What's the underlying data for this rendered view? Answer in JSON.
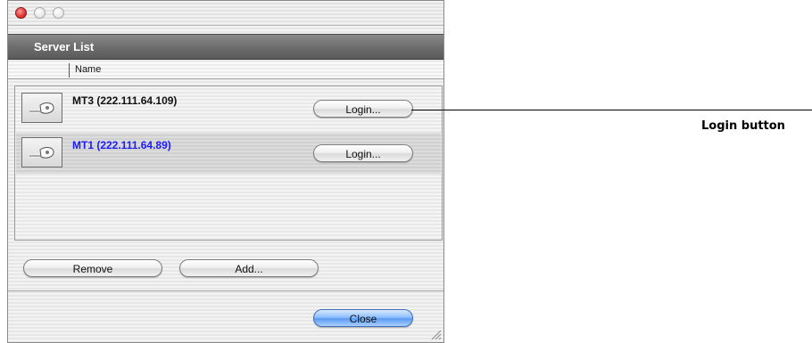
{
  "window": {
    "header_title": "Server List",
    "column_header": "Name"
  },
  "servers": [
    {
      "name": "MT3 (222.111.64.109)",
      "login_label": "Login...",
      "selected": false
    },
    {
      "name": "MT1 (222.111.64.89)",
      "login_label": "Login...",
      "selected": true
    }
  ],
  "actions": {
    "remove_label": "Remove",
    "add_label": "Add...",
    "close_label": "Close"
  },
  "callout": {
    "label": "Login button"
  },
  "colors": {
    "selected_text": "#1a1aff",
    "header_bar": "#6e6e6e",
    "primary_button": "#5c9bf2",
    "close_light": "#e0393b"
  },
  "icons": {
    "server": "server-key-icon",
    "close_light": "close-window-icon",
    "minimize_light": "minimize-window-icon",
    "zoom_light": "zoom-window-icon",
    "resize": "resize-grip-icon"
  }
}
